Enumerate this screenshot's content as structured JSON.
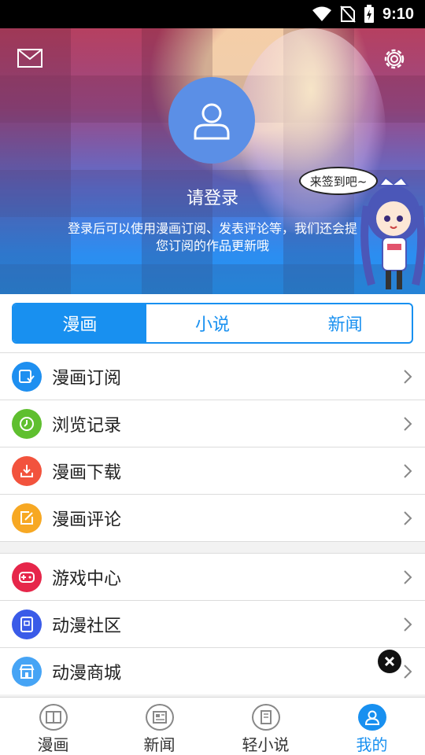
{
  "status_bar": {
    "time": "9:10"
  },
  "header": {
    "login_title": "请登录",
    "login_desc_line1": "登录后可以使用漫画订阅、发表评论等，我们还会提",
    "login_desc_line2": "您订阅的作品更新哦",
    "signin_bubble": "来签到吧~"
  },
  "segments": [
    {
      "label": "漫画",
      "active": true
    },
    {
      "label": "小说",
      "active": false
    },
    {
      "label": "新闻",
      "active": false
    }
  ],
  "list_group_1": [
    {
      "label": "漫画订阅",
      "icon": "subscribe-icon",
      "color": "#1e8ff0"
    },
    {
      "label": "浏览记录",
      "icon": "clock-icon",
      "color": "#5fbf2f"
    },
    {
      "label": "漫画下载",
      "icon": "download-icon",
      "color": "#f2533d"
    },
    {
      "label": "漫画评论",
      "icon": "edit-icon",
      "color": "#f7a823"
    }
  ],
  "list_group_2": [
    {
      "label": "游戏中心",
      "icon": "gamepad-icon",
      "color": "#e6264a"
    },
    {
      "label": "动漫社区",
      "icon": "community-icon",
      "color": "#3a5be8"
    },
    {
      "label": "动漫商城",
      "icon": "shop-icon",
      "color": "#46a4f5"
    }
  ],
  "tabbar": [
    {
      "label": "漫画",
      "icon": "book-icon",
      "active": false
    },
    {
      "label": "新闻",
      "icon": "news-icon",
      "active": false
    },
    {
      "label": "轻小说",
      "icon": "novel-icon",
      "active": false
    },
    {
      "label": "我的",
      "icon": "profile-icon",
      "active": true
    }
  ],
  "colors": {
    "accent": "#1890f0",
    "divider": "#dcdcdc"
  }
}
